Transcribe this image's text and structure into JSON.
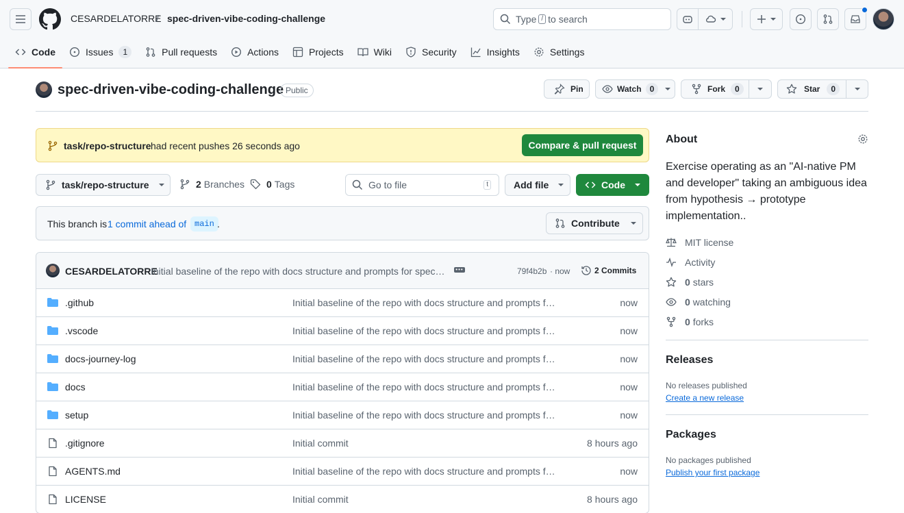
{
  "header": {
    "owner": "CESARDELATORRE",
    "separator": "/",
    "repo": "spec-driven-vibe-coding-challenge",
    "search_prefix": "Type",
    "search_key": "/",
    "search_suffix": "to search"
  },
  "tabs": [
    {
      "label": "Code",
      "icon": "code-icon"
    },
    {
      "label": "Issues",
      "icon": "issue-icon",
      "count": "1"
    },
    {
      "label": "Pull requests",
      "icon": "pull-request-icon"
    },
    {
      "label": "Actions",
      "icon": "play-icon"
    },
    {
      "label": "Projects",
      "icon": "table-icon"
    },
    {
      "label": "Wiki",
      "icon": "book-icon"
    },
    {
      "label": "Security",
      "icon": "shield-icon"
    },
    {
      "label": "Insights",
      "icon": "graph-icon"
    },
    {
      "label": "Settings",
      "icon": "gear-icon"
    }
  ],
  "repo_title": {
    "name": "spec-driven-vibe-coding-challenge",
    "visibility": "Public",
    "pin": "Pin",
    "watch": "Watch",
    "watch_count": "0",
    "fork": "Fork",
    "fork_count": "0",
    "star": "Star",
    "star_count": "0"
  },
  "flash": {
    "branch": "task/repo-structure",
    "text": "had recent pushes 26 seconds ago",
    "button": "Compare & pull request"
  },
  "toolbar": {
    "branch": "task/repo-structure",
    "branches_count": "2",
    "branches_label": "Branches",
    "tags_count": "0",
    "tags_label": "Tags",
    "goto_placeholder": "Go to file",
    "goto_key": "t",
    "add_file": "Add file",
    "code": "Code"
  },
  "ahead": {
    "prefix": "This branch is",
    "link": "1 commit ahead of",
    "base": "main",
    "suffix": ".",
    "contribute": "Contribute"
  },
  "commit": {
    "author": "CESARDELATORRE",
    "message": "Initial baseline of the repo with docs structure and prompts for spec…",
    "hash": "79f4b2b",
    "time": "· now",
    "commits": "2 Commits"
  },
  "files": [
    {
      "type": "dir",
      "name": ".github",
      "message": "Initial baseline of the repo with docs structure and prompts f…",
      "age": "now"
    },
    {
      "type": "dir",
      "name": ".vscode",
      "message": "Initial baseline of the repo with docs structure and prompts f…",
      "age": "now"
    },
    {
      "type": "dir",
      "name": "docs-journey-log",
      "message": "Initial baseline of the repo with docs structure and prompts f…",
      "age": "now"
    },
    {
      "type": "dir",
      "name": "docs",
      "message": "Initial baseline of the repo with docs structure and prompts f…",
      "age": "now"
    },
    {
      "type": "dir",
      "name": "setup",
      "message": "Initial baseline of the repo with docs structure and prompts f…",
      "age": "now"
    },
    {
      "type": "file",
      "name": ".gitignore",
      "message": "Initial commit",
      "age": "8 hours ago"
    },
    {
      "type": "file",
      "name": "AGENTS.md",
      "message": "Initial baseline of the repo with docs structure and prompts f…",
      "age": "now"
    },
    {
      "type": "file",
      "name": "LICENSE",
      "message": "Initial commit",
      "age": "8 hours ago"
    }
  ],
  "about": {
    "title": "About",
    "description": "Exercise operating as an \"AI-native PM and developer\" taking an ambiguous idea from hypothesis → prototype implementation..",
    "license": "MIT license",
    "activity": "Activity",
    "stars_count": "0",
    "stars_label": "stars",
    "watching_count": "0",
    "watching_label": "watching",
    "forks_count": "0",
    "forks_label": "forks"
  },
  "releases": {
    "title": "Releases",
    "empty": "No releases published",
    "link": "Create a new release"
  },
  "packages": {
    "title": "Packages",
    "empty": "No packages published",
    "link": "Publish your first package"
  },
  "colors": {
    "accent": "#0969da",
    "green": "#1f883d",
    "tab_underline": "#fd8c73",
    "folder": "#54aeff"
  }
}
